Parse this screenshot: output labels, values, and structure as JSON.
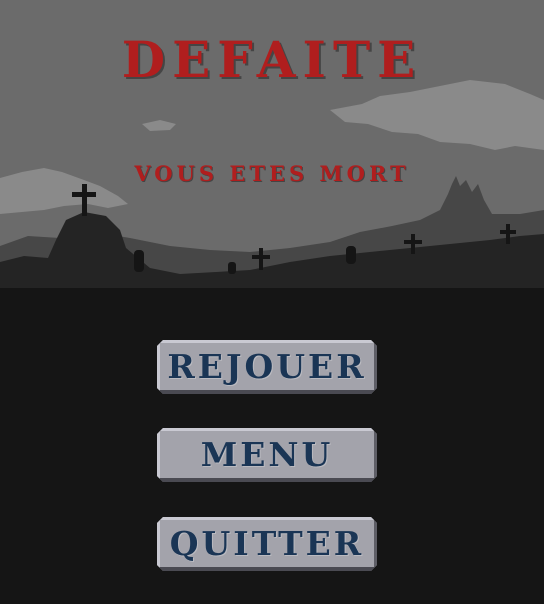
{
  "screen": {
    "title": "DEFAITE",
    "subtitle": "VOUS ETES MORT"
  },
  "buttons": {
    "replay": "REJOUER",
    "menu": "MENU",
    "quit": "QUITTER"
  },
  "colors": {
    "sky": "#6b6b6b",
    "cloud": "#8a8a8a",
    "hill_far": "#474747",
    "hill_near": "#242424",
    "ground": "#151515",
    "title_red": "#b01e1e",
    "button_face": "#a3a3ab",
    "button_text": "#1a3555"
  }
}
